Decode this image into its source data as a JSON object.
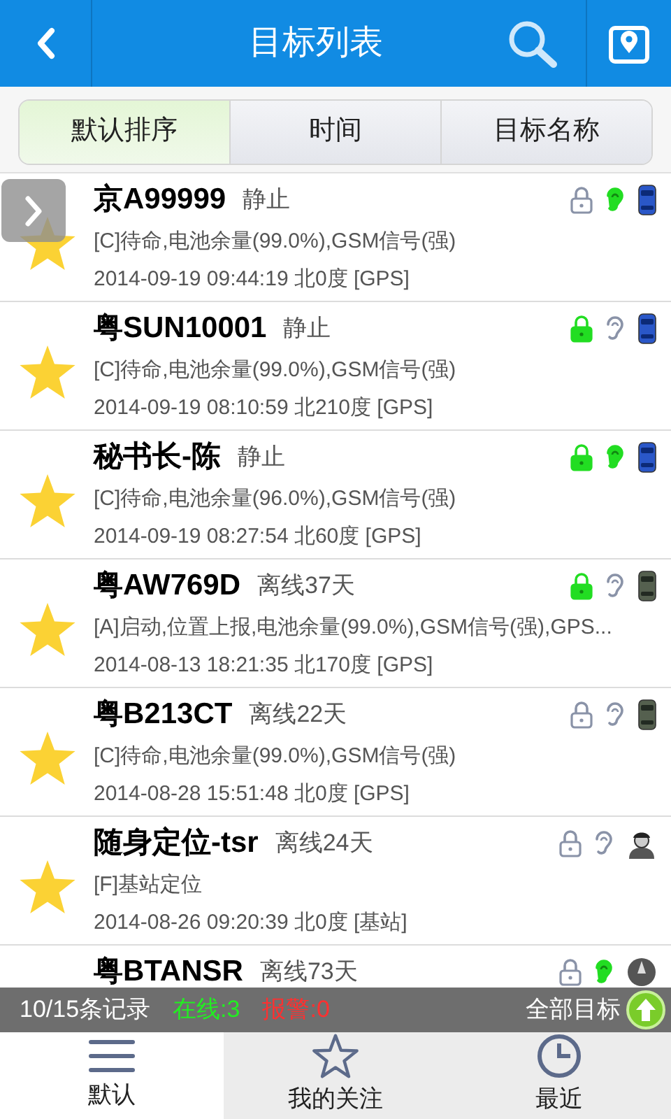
{
  "header": {
    "title": "目标列表"
  },
  "sort_tabs": [
    {
      "label": "默认排序",
      "selected": true
    },
    {
      "label": "时间",
      "selected": false
    },
    {
      "label": "目标名称",
      "selected": false
    }
  ],
  "targets": [
    {
      "name": "京A99999",
      "status": "静止",
      "detail": "[C]待命,电池余量(99.0%),GSM信号(强)",
      "time": "2014-09-19 09:44:19 北0度 [GPS]",
      "locked": false,
      "listening": true,
      "kind": "car_blue"
    },
    {
      "name": "粤SUN10001",
      "status": "静止",
      "detail": "[C]待命,电池余量(99.0%),GSM信号(强)",
      "time": "2014-09-19 08:10:59 北210度 [GPS]",
      "locked": true,
      "listening": false,
      "kind": "car_blue"
    },
    {
      "name": "秘书长-陈",
      "status": "静止",
      "detail": "[C]待命,电池余量(96.0%),GSM信号(强)",
      "time": "2014-09-19 08:27:54 北60度 [GPS]",
      "locked": true,
      "listening": true,
      "kind": "car_blue"
    },
    {
      "name": "粤AW769D",
      "status": "离线37天",
      "detail": "[A]启动,位置上报,电池余量(99.0%),GSM信号(强),GPS...",
      "time": "2014-08-13 18:21:35 北170度 [GPS]",
      "locked": true,
      "listening": false,
      "kind": "car_gray"
    },
    {
      "name": "粤B213CT",
      "status": "离线22天",
      "detail": "[C]待命,电池余量(99.0%),GSM信号(强)",
      "time": "2014-08-28 15:51:48 北0度 [GPS]",
      "locked": false,
      "listening": false,
      "kind": "car_gray"
    },
    {
      "name": "随身定位-tsr",
      "status": "离线24天",
      "detail": "[F]基站定位",
      "time": "2014-08-26 09:20:39 北0度 [基站]",
      "locked": false,
      "listening": false,
      "kind": "person"
    },
    {
      "name": "粤BTANSR",
      "status": "离线73天",
      "locked": false,
      "listening": true,
      "kind": "compass"
    }
  ],
  "summary": {
    "records": "10/15条记录",
    "online": "在线:3",
    "alarms": "报警:0",
    "all_targets": "全部目标"
  },
  "bottom_tabs": [
    {
      "label": "默认",
      "selected": true
    },
    {
      "label": "我的关注",
      "selected": false
    },
    {
      "label": "最近",
      "selected": false
    }
  ]
}
